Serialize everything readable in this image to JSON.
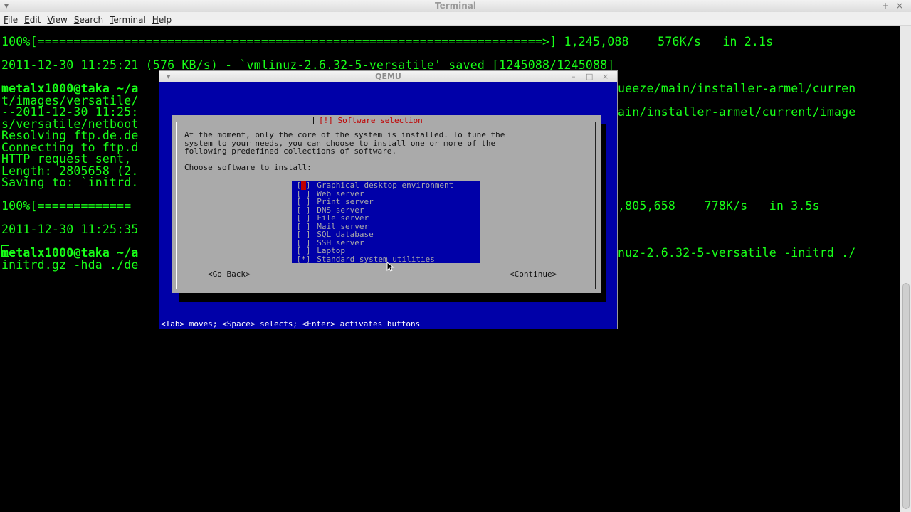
{
  "window": {
    "title": "Terminal",
    "controls": [
      "–",
      "+",
      "×"
    ]
  },
  "menubar": [
    {
      "label": "File",
      "u": "F",
      "rest": "ile"
    },
    {
      "label": "Edit",
      "u": "E",
      "rest": "dit"
    },
    {
      "label": "View",
      "u": "V",
      "rest": "iew"
    },
    {
      "label": "Search",
      "u": "S",
      "rest": "earch"
    },
    {
      "label": "Terminal",
      "u": "T",
      "rest": "erminal"
    },
    {
      "label": "Help",
      "u": "H",
      "rest": "elp"
    }
  ],
  "terminal": {
    "lines": [
      "100%[======================================================================>] 1,245,088    576K/s   in 2.1s",
      "",
      "2011-12-30 11:25:21 (576 KB/s) - `vmlinuz-2.6.32-5-versatile' saved [1245088/1245088]",
      "",
      "metalx1000@taka ~/a",
      "t/images/versatile/",
      "--2011-12-30 11:25:",
      "s/versatile/netboot",
      "Resolving ftp.de.de",
      "Connecting to ftp.d",
      "HTTP request sent, ",
      "Length: 2805658 (2.",
      "Saving to: `initrd.",
      "",
      "100%[=============",
      "",
      "2011-12-30 11:25:35",
      "",
      "metalx1000@taka ~/a",
      "initrd.gz -hda ./de"
    ],
    "right_lines": [
      {
        "text": "ueeze/main/installer-armel/curren",
        "row": 4
      },
      {
        "text": "ain/installer-armel/current/image",
        "row": 6
      },
      {
        "text": ",805,658    778K/s   in 3.5s",
        "row": 14
      },
      {
        "text": "nuz-2.6.32-5-versatile -initrd ./",
        "row": 18
      }
    ]
  },
  "qemu": {
    "title": "QEMU",
    "controls": [
      "–",
      "□",
      "×"
    ],
    "dialog": {
      "title": "[!] Software selection",
      "description": [
        "At the moment, only the core of the system is installed. To tune the",
        "system to your needs, you can choose to install one or more of the",
        "following predefined collections of software."
      ],
      "prompt": "Choose software to install:",
      "items": [
        {
          "label": "Graphical desktop environment",
          "checked": "*",
          "focused": true
        },
        {
          "label": "Web server",
          "checked": " "
        },
        {
          "label": "Print server",
          "checked": " "
        },
        {
          "label": "DNS server",
          "checked": " "
        },
        {
          "label": "File server",
          "checked": " "
        },
        {
          "label": "Mail server",
          "checked": " "
        },
        {
          "label": "SQL database",
          "checked": " "
        },
        {
          "label": "SSH server",
          "checked": " "
        },
        {
          "label": "Laptop",
          "checked": " "
        },
        {
          "label": "Standard system utilities",
          "checked": "*"
        }
      ],
      "go_back": "<Go Back>",
      "continue": "<Continue>"
    },
    "status": "<Tab> moves; <Space> selects; <Enter> activates buttons"
  }
}
